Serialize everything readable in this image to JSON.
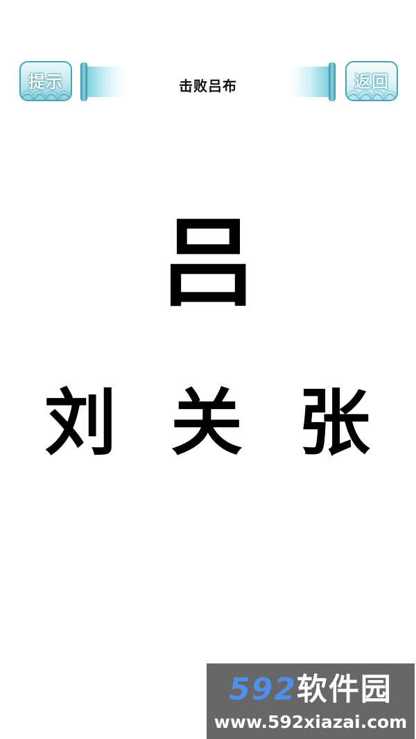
{
  "header": {
    "hint_button": "提示",
    "title": "击败吕布",
    "back_button": "返回"
  },
  "puzzle": {
    "target_char": "吕",
    "options": [
      "刘",
      "关",
      "张"
    ]
  },
  "watermark": {
    "number": "592",
    "brand": "软件园",
    "url": "www.592xiazai.com"
  },
  "colors": {
    "accent": "#4aa3b5",
    "scroll_light": "#bfe9f1",
    "watermark_blue": "#4f8fe8"
  }
}
